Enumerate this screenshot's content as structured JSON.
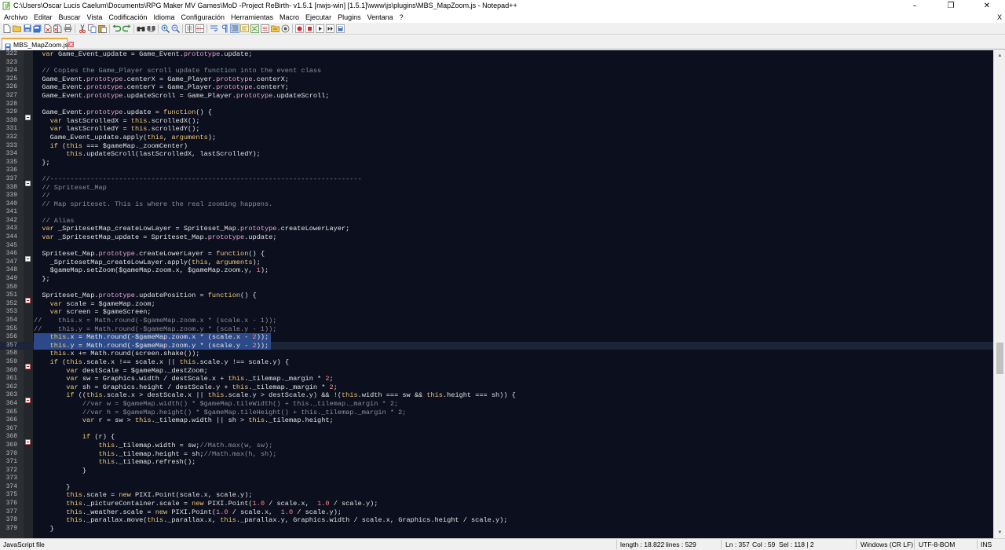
{
  "window": {
    "title": "C:\\Users\\Oscar Lucis Caelum\\Documents\\RPG Maker MV Games\\MoD -Project ReBirth- v1.5.1 [nwjs-win] [1.5.1]\\www\\js\\plugins\\MBS_MapZoom.js - Notepad++",
    "minimize": "–",
    "maximize": "❐",
    "close": "✕"
  },
  "menu": {
    "items": [
      "Archivo",
      "Editar",
      "Buscar",
      "Vista",
      "Codificación",
      "Idioma",
      "Configuración",
      "Herramientas",
      "Macro",
      "Ejecutar",
      "Plugins",
      "Ventana",
      "?"
    ],
    "close_doc": "X"
  },
  "tab": {
    "label": "MBS_MapZoom.js"
  },
  "editor": {
    "selection_color": "#2c4a88",
    "background": "#0b0f1e",
    "lines": [
      {
        "n": "322",
        "fold": "",
        "t": "  var Game_Event_update = Game_Event.prototype.update;"
      },
      {
        "n": "323",
        "fold": "",
        "t": ""
      },
      {
        "n": "324",
        "fold": "",
        "t": "  // Copies the Game_Player scroll update function into the event class"
      },
      {
        "n": "325",
        "fold": "",
        "t": "  Game_Event.prototype.centerX = Game_Player.prototype.centerX;"
      },
      {
        "n": "326",
        "fold": "",
        "t": "  Game_Event.prototype.centerY = Game_Player.prototype.centerY;"
      },
      {
        "n": "327",
        "fold": "",
        "t": "  Game_Event.prototype.updateScroll = Game_Player.prototype.updateScroll;"
      },
      {
        "n": "328",
        "fold": "",
        "t": ""
      },
      {
        "n": "329",
        "fold": "minus",
        "t": "  Game_Event.prototype.update = function() {"
      },
      {
        "n": "330",
        "fold": "",
        "t": "    var lastScrolledX = this.scrolledX();"
      },
      {
        "n": "331",
        "fold": "",
        "t": "    var lastScrolledY = this.scrolledY();"
      },
      {
        "n": "332",
        "fold": "",
        "t": "    Game_Event_update.apply(this, arguments);"
      },
      {
        "n": "333",
        "fold": "",
        "t": "    if (this === $gameMap._zoomCenter)"
      },
      {
        "n": "334",
        "fold": "",
        "t": "        this.updateScroll(lastScrolledX, lastScrolledY);"
      },
      {
        "n": "335",
        "fold": "",
        "t": "  };"
      },
      {
        "n": "336",
        "fold": "",
        "t": ""
      },
      {
        "n": "337",
        "fold": "minus",
        "t": "  //-----------------------------------------------------------------------------"
      },
      {
        "n": "338",
        "fold": "",
        "t": "  // Spriteset_Map"
      },
      {
        "n": "339",
        "fold": "",
        "t": "  //"
      },
      {
        "n": "340",
        "fold": "",
        "t": "  // Map spriteset. This is where the real zooming happens."
      },
      {
        "n": "341",
        "fold": "",
        "t": ""
      },
      {
        "n": "342",
        "fold": "",
        "t": "  // Alias"
      },
      {
        "n": "343",
        "fold": "",
        "t": "  var _SpritesetMap_createLowLayer = Spriteset_Map.prototype.createLowerLayer;"
      },
      {
        "n": "344",
        "fold": "",
        "t": "  var _SpritesetMap_update = Spriteset_Map.prototype.update;"
      },
      {
        "n": "345",
        "fold": "",
        "t": ""
      },
      {
        "n": "346",
        "fold": "minus",
        "t": "  Spriteset_Map.prototype.createLowerLayer = function() {"
      },
      {
        "n": "347",
        "fold": "",
        "t": "    _SpritesetMap_createLowLayer.apply(this, arguments);"
      },
      {
        "n": "348",
        "fold": "",
        "t": "    $gameMap.setZoom($gameMap.zoom.x, $gameMap.zoom.y, 1);"
      },
      {
        "n": "349",
        "fold": "",
        "t": "  };"
      },
      {
        "n": "350",
        "fold": "",
        "t": ""
      },
      {
        "n": "351",
        "fold": "minus-red",
        "t": "  Spriteset_Map.prototype.updatePosition = function() {"
      },
      {
        "n": "352",
        "fold": "",
        "t": "    var scale = $gameMap.zoom;"
      },
      {
        "n": "353",
        "fold": "",
        "t": "    var screen = $gameScreen;"
      },
      {
        "n": "354",
        "fold": "",
        "t": "//    this.x = Math.round(-$gameMap.zoom.x * (scale.x - 1));"
      },
      {
        "n": "355",
        "fold": "",
        "t": "//    this.y = Math.round(-$gameMap.zoom.y * (scale.y - 1));"
      },
      {
        "n": "356",
        "fold": "",
        "t": "    this.x = Math.round(-$gameMap.zoom.x * (scale.x - 2));",
        "sel": true
      },
      {
        "n": "357",
        "fold": "",
        "t": "    this.y = Math.round(-$gameMap.zoom.y * (scale.y - 2));",
        "sel": true,
        "caret": true
      },
      {
        "n": "358",
        "fold": "",
        "t": "    this.x += Math.round(screen.shake());"
      },
      {
        "n": "359",
        "fold": "minus-red",
        "t": "    if (this.scale.x !== scale.x || this.scale.y !== scale.y) {"
      },
      {
        "n": "360",
        "fold": "",
        "t": "        var destScale = $gameMap._destZoom;"
      },
      {
        "n": "361",
        "fold": "",
        "t": "        var sw = Graphics.width / destScale.x + this._tilemap._margin * 2;"
      },
      {
        "n": "362",
        "fold": "",
        "t": "        var sh = Graphics.height / destScale.y + this._tilemap._margin * 2;"
      },
      {
        "n": "363",
        "fold": "minus-red",
        "t": "        if ((this.scale.x > destScale.x || this.scale.y > destScale.y) && !(this.width === sw && this.height === sh)) {"
      },
      {
        "n": "364",
        "fold": "",
        "t": "            //var w = $gameMap.width() * $gameMap.tileWidth() + this._tilemap._margin * 2;"
      },
      {
        "n": "365",
        "fold": "",
        "t": "            //var h = $gameMap.height() * $gameMap.tileHeight() + this._tilemap._margin * 2;"
      },
      {
        "n": "366",
        "fold": "",
        "t": "            var r = sw > this._tilemap.width || sh > this._tilemap.height;"
      },
      {
        "n": "367",
        "fold": "",
        "t": ""
      },
      {
        "n": "368",
        "fold": "minus-red",
        "t": "            if (r) {"
      },
      {
        "n": "369",
        "fold": "",
        "t": "                this._tilemap.width = sw;//Math.max(w, sw);"
      },
      {
        "n": "370",
        "fold": "",
        "t": "                this._tilemap.height = sh;//Math.max(h, sh);"
      },
      {
        "n": "371",
        "fold": "",
        "t": "                this._tilemap.refresh();"
      },
      {
        "n": "372",
        "fold": "",
        "t": "            }"
      },
      {
        "n": "373",
        "fold": "",
        "t": ""
      },
      {
        "n": "374",
        "fold": "",
        "t": "        }"
      },
      {
        "n": "375",
        "fold": "",
        "t": "        this.scale = new PIXI.Point(scale.x, scale.y);"
      },
      {
        "n": "376",
        "fold": "",
        "t": "        this._pictureContainer.scale = new PIXI.Point(1.0 / scale.x,  1.0 / scale.y);"
      },
      {
        "n": "377",
        "fold": "",
        "t": "        this._weather.scale = new PIXI.Point(1.0 / scale.x,  1.0 / scale.y);"
      },
      {
        "n": "378",
        "fold": "",
        "t": "        this._parallax.move(this._parallax.x, this._parallax.y, Graphics.width / scale.x, Graphics.height / scale.y);"
      },
      {
        "n": "379",
        "fold": "",
        "t": "    }"
      }
    ]
  },
  "scrollbar": {
    "up": "▲",
    "down": "▼"
  },
  "status": {
    "type": "JavaScript file",
    "length": "length : 18.822",
    "lines": "lines : 529",
    "ln": "Ln : 357",
    "col": "Col : 59",
    "sel": "Sel : 118 | 2",
    "eol": "Windows (CR LF)",
    "encoding": "UTF-8-BOM",
    "mode": "INS"
  }
}
